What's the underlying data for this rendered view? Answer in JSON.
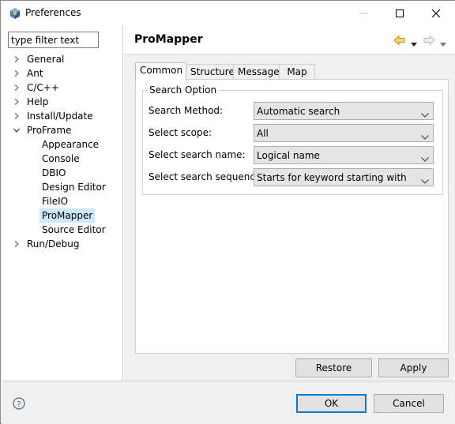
{
  "window": {
    "title": "Preferences",
    "icon": "eclipse-preferences-icon"
  },
  "filter": {
    "value": "type filter text"
  },
  "tree": [
    {
      "label": "General",
      "expandable": true,
      "expanded": false
    },
    {
      "label": "Ant",
      "expandable": true,
      "expanded": false
    },
    {
      "label": "C/C++",
      "expandable": true,
      "expanded": false
    },
    {
      "label": "Help",
      "expandable": true,
      "expanded": false
    },
    {
      "label": "Install/Update",
      "expandable": true,
      "expanded": false
    },
    {
      "label": "ProFrame",
      "expandable": true,
      "expanded": true,
      "children": [
        {
          "label": "Appearance"
        },
        {
          "label": "Console"
        },
        {
          "label": "DBIO"
        },
        {
          "label": "Design Editor"
        },
        {
          "label": "FileIO"
        },
        {
          "label": "ProMapper",
          "selected": true
        },
        {
          "label": "Source Editor"
        }
      ]
    },
    {
      "label": "Run/Debug",
      "expandable": true,
      "expanded": false
    }
  ],
  "page": {
    "title": "ProMapper"
  },
  "tabs": [
    {
      "label": "Common",
      "active": true
    },
    {
      "label": "Structure",
      "active": false
    },
    {
      "label": "Message",
      "active": false
    },
    {
      "label": "Map",
      "active": false
    }
  ],
  "search_option": {
    "group_title": "Search Option",
    "rows": [
      {
        "label": "Search Method:",
        "value": "Automatic search"
      },
      {
        "label": "Select scope:",
        "value": "All"
      },
      {
        "label": "Select search name:",
        "value": "Logical name"
      },
      {
        "label": "Select search sequence:",
        "value": "Starts for keyword starting with"
      }
    ]
  },
  "buttons": {
    "restore_defaults": "Restore Defaults",
    "apply": "Apply",
    "ok": "OK",
    "cancel": "Cancel"
  },
  "colors": {
    "selection": "#cce8ff",
    "default_button_border": "#0078d7",
    "back_arrow": "#e8a417"
  }
}
